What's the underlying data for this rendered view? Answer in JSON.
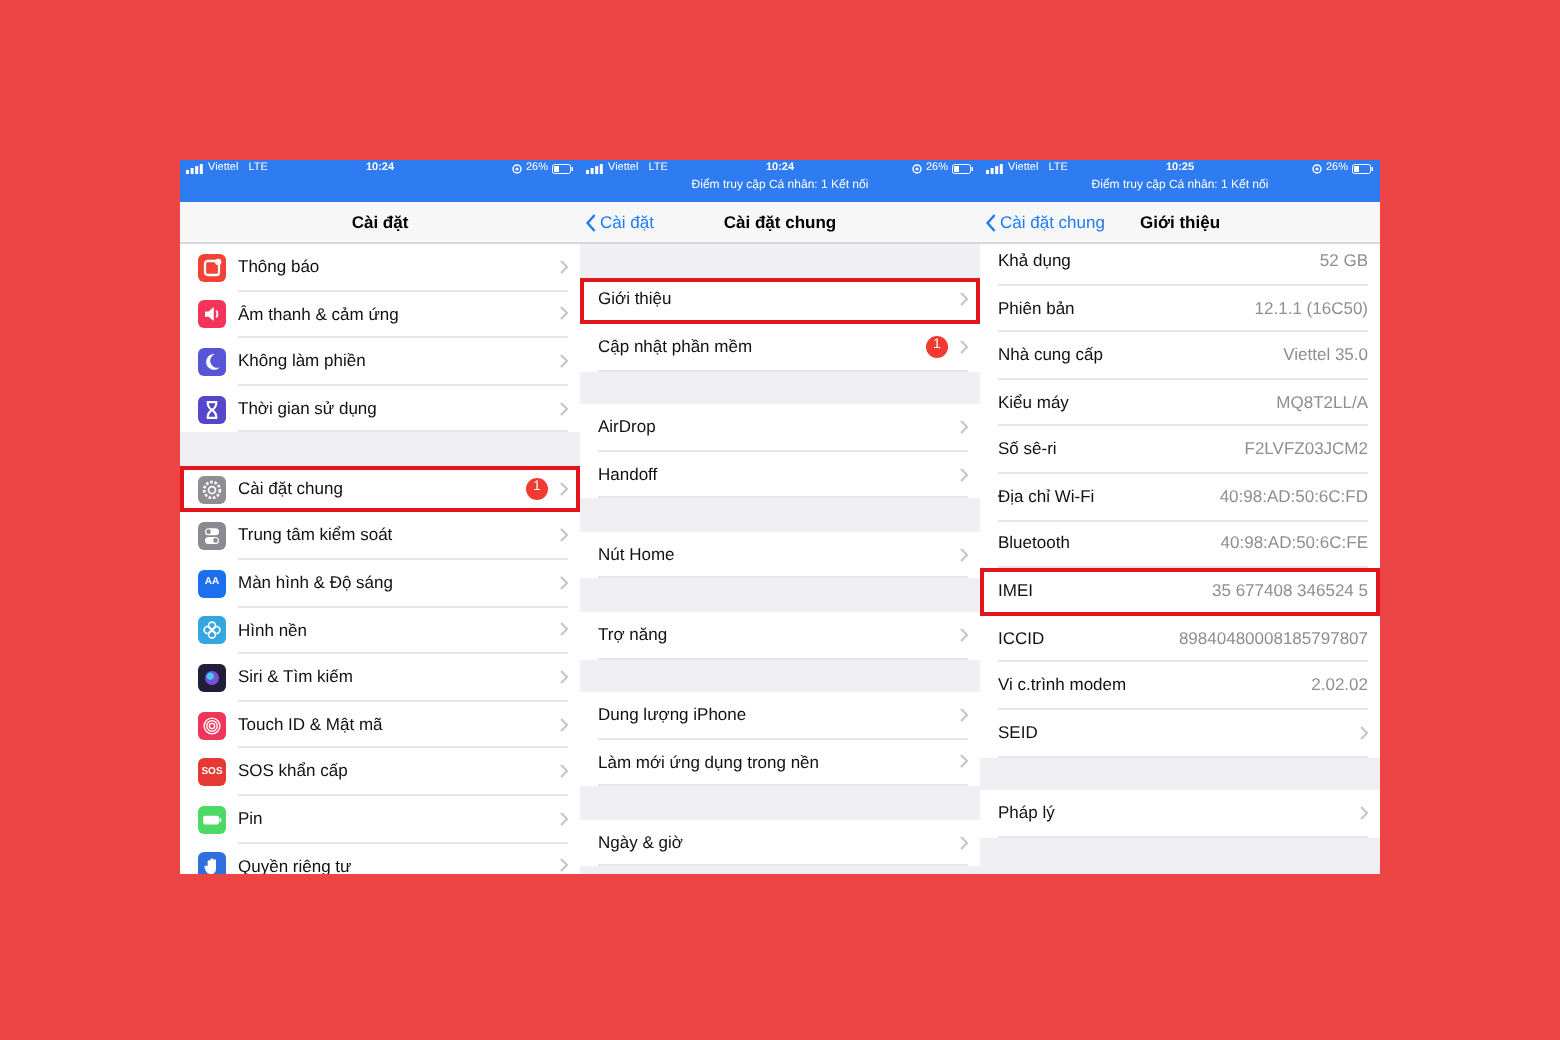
{
  "panels": [
    {
      "status": {
        "carrier": "Viettel",
        "network": "LTE",
        "time": "10:24",
        "battery": "26%"
      },
      "nav": {
        "title": "Cài đặt"
      },
      "scrolled": false,
      "groups": [
        [
          {
            "label": "Thông báo",
            "chevron": true,
            "highlighted": false,
            "icon": {
              "kind": "bell",
              "color": "#f44336"
            }
          },
          {
            "label": "Âm thanh & cảm ứng",
            "chevron": true,
            "highlighted": false,
            "icon": {
              "kind": "speaker",
              "color": "#f2335a"
            }
          },
          {
            "label": "Không làm phiền",
            "chevron": true,
            "highlighted": false,
            "icon": {
              "kind": "moon",
              "color": "#5856d6"
            }
          },
          {
            "label": "Thời gian sử dụng",
            "chevron": true,
            "highlighted": false,
            "icon": {
              "kind": "hourglass",
              "color": "#5447c9"
            }
          }
        ],
        [
          {
            "label": "Cài đặt chung",
            "badge": "1",
            "chevron": true,
            "highlighted": true,
            "icon": {
              "kind": "gear",
              "color": "#8e8e93"
            }
          },
          {
            "label": "Trung tâm kiểm soát",
            "chevron": true,
            "highlighted": false,
            "icon": {
              "kind": "toggles",
              "color": "#8a8a90"
            }
          },
          {
            "label": "Màn hình & Độ sáng",
            "chevron": true,
            "highlighted": false,
            "icon": {
              "kind": "letters",
              "color": "#1e6ff0",
              "text": "AA"
            }
          },
          {
            "label": "Hình nền",
            "chevron": true,
            "highlighted": false,
            "icon": {
              "kind": "flower",
              "color": "#35a7e0"
            }
          },
          {
            "label": "Siri & Tìm kiếm",
            "chevron": true,
            "highlighted": false,
            "icon": {
              "kind": "orb",
              "color": "#1f1f3a"
            }
          },
          {
            "label": "Touch ID & Mật mã",
            "chevron": true,
            "highlighted": false,
            "icon": {
              "kind": "fingerprint",
              "color": "#f0355a"
            }
          },
          {
            "label": "SOS khẩn cấp",
            "chevron": true,
            "highlighted": false,
            "icon": {
              "kind": "letters",
              "color": "#e53935",
              "text": "SOS"
            }
          },
          {
            "label": "Pin",
            "chevron": true,
            "highlighted": false,
            "icon": {
              "kind": "battery",
              "color": "#4cd964"
            }
          },
          {
            "label": "Quyền riêng tư",
            "chevron": true,
            "highlighted": false,
            "icon": {
              "kind": "hand",
              "color": "#2f6fe0"
            }
          }
        ]
      ]
    },
    {
      "status": {
        "carrier": "Viettel",
        "network": "LTE",
        "time": "10:24",
        "battery": "26%",
        "hotspot": "Điểm truy cập Cá nhân: 1 Kết nối"
      },
      "nav": {
        "back": "Cài đặt",
        "title": "Cài đặt chung"
      },
      "scrolled": false,
      "groups": [
        [
          {
            "label": "Giới thiệu",
            "chevron": true,
            "highlighted": true
          },
          {
            "label": "Cập nhật phần mềm",
            "badge": "1",
            "chevron": true,
            "highlighted": false
          }
        ],
        [
          {
            "label": "AirDrop",
            "chevron": true,
            "highlighted": false
          },
          {
            "label": "Handoff",
            "chevron": true,
            "highlighted": false
          }
        ],
        [
          {
            "label": "Nút Home",
            "chevron": true,
            "highlighted": false
          }
        ],
        [
          {
            "label": "Trợ năng",
            "chevron": true,
            "highlighted": false
          }
        ],
        [
          {
            "label": "Dung lượng iPhone",
            "chevron": true,
            "highlighted": false
          },
          {
            "label": "Làm mới ứng dụng trong nền",
            "chevron": true,
            "highlighted": false
          }
        ],
        [
          {
            "label": "Ngày & giờ",
            "chevron": true,
            "highlighted": false
          }
        ]
      ]
    },
    {
      "status": {
        "carrier": "Viettel",
        "network": "LTE",
        "time": "10:25",
        "battery": "26%",
        "hotspot": "Điểm truy cập Cá nhân: 1 Kết nối"
      },
      "nav": {
        "back": "Cài đặt chung",
        "title": "Giới thiệu"
      },
      "scrolled": true,
      "groups": [
        [
          {
            "label": "Khả dụng",
            "value": "52 GB",
            "chevron": false,
            "highlighted": false
          },
          {
            "label": "Phiên bản",
            "value": "12.1.1 (16C50)",
            "chevron": false,
            "highlighted": false
          },
          {
            "label": "Nhà cung cấp",
            "value": "Viettel 35.0",
            "chevron": false,
            "highlighted": false
          },
          {
            "label": "Kiểu máy",
            "value": "MQ8T2LL/A",
            "chevron": false,
            "highlighted": false
          },
          {
            "label": "Số sê-ri",
            "value": "F2LVFZ03JCM2",
            "chevron": false,
            "highlighted": false
          },
          {
            "label": "Địa chỉ Wi-Fi",
            "value": "40:98:AD:50:6C:FD",
            "chevron": false,
            "highlighted": false
          },
          {
            "label": "Bluetooth",
            "value": "40:98:AD:50:6C:FE",
            "chevron": false,
            "highlighted": false
          },
          {
            "label": "IMEI",
            "value": "35 677408 346524 5",
            "chevron": false,
            "highlighted": true
          },
          {
            "label": "ICCID",
            "value": "89840480008185797807",
            "chevron": false,
            "highlighted": false
          },
          {
            "label": "Vi c.trình modem",
            "value": "2.02.02",
            "chevron": false,
            "highlighted": false
          },
          {
            "label": "SEID",
            "chevron": true,
            "highlighted": false
          }
        ],
        [
          {
            "label": "Pháp lý",
            "chevron": true,
            "highlighted": false
          }
        ]
      ]
    }
  ]
}
